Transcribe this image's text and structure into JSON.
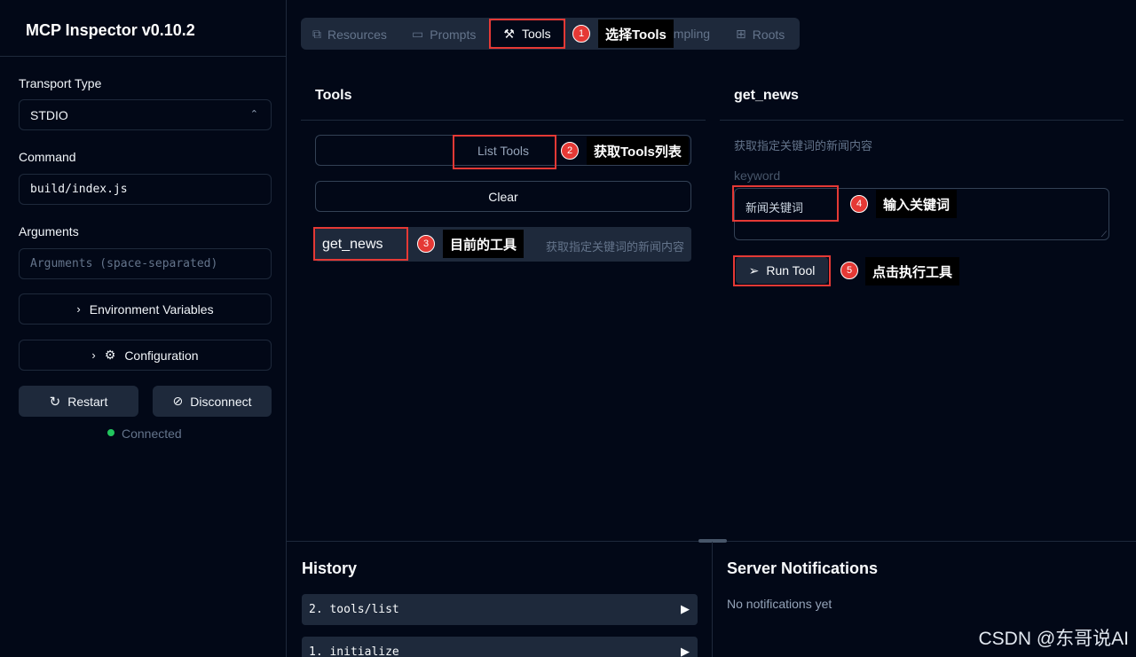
{
  "sidebar": {
    "title": "MCP Inspector v0.10.2",
    "transport_label": "Transport Type",
    "transport_value": "STDIO",
    "command_label": "Command",
    "command_value": "build/index.js",
    "arguments_label": "Arguments",
    "arguments_placeholder": "Arguments (space-separated)",
    "env_vars_label": "Environment Variables",
    "config_label": "Configuration",
    "restart_label": "Restart",
    "disconnect_label": "Disconnect",
    "status": "Connected"
  },
  "tabs": [
    {
      "label": "Resources",
      "icon": "files-icon"
    },
    {
      "label": "Prompts",
      "icon": "message-icon"
    },
    {
      "label": "Tools",
      "icon": "hammer-icon",
      "active": true
    },
    {
      "label": "Sampling",
      "icon": "hash-icon",
      "visible_fragment": "ampling"
    },
    {
      "label": "Roots",
      "icon": "folder-tree-icon"
    }
  ],
  "tools_panel": {
    "title": "Tools",
    "list_button": "List Tools",
    "clear_button": "Clear",
    "tool": {
      "name": "get_news",
      "description": "获取指定关键词的新闻内容"
    }
  },
  "detail_panel": {
    "title": "get_news",
    "description": "获取指定关键词的新闻内容",
    "param_label": "keyword",
    "param_value": "新闻关键词",
    "run_button": "Run Tool"
  },
  "history": {
    "title": "History",
    "items": [
      "2. tools/list",
      "1. initialize"
    ]
  },
  "notifications": {
    "title": "Server Notifications",
    "empty": "No notifications yet"
  },
  "annotations": [
    {
      "num": "1",
      "text": "选择Tools"
    },
    {
      "num": "2",
      "text": "获取Tools列表"
    },
    {
      "num": "3",
      "text": "目前的工具"
    },
    {
      "num": "4",
      "text": "输入关键词"
    },
    {
      "num": "5",
      "text": "点击执行工具"
    }
  ],
  "watermark": "CSDN @东哥说AI",
  "colors": {
    "background": "#020817",
    "surface": "#1e293b",
    "border": "#1e293b",
    "status_green": "#22c55e",
    "annotation_red": "#e53935"
  }
}
